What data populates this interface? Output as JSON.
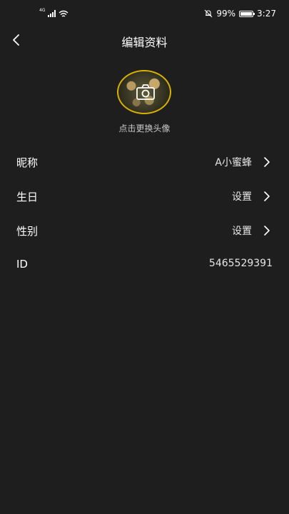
{
  "status_bar": {
    "network": "4G",
    "battery_percent": "99%",
    "battery_level": 0.99,
    "time": "3:27"
  },
  "header": {
    "title": "编辑资料"
  },
  "avatar": {
    "caption": "点击更换头像"
  },
  "profile": {
    "nickname": {
      "label": "昵称",
      "value": "A小蜜蜂"
    },
    "birthday": {
      "label": "生日",
      "value": "设置"
    },
    "gender": {
      "label": "性别",
      "value": "设置"
    },
    "id": {
      "label": "ID",
      "value": "5465529391"
    }
  },
  "colors": {
    "background": "#1e1e1e",
    "avatar_border": "#d9b000",
    "text": "#ffffff"
  }
}
